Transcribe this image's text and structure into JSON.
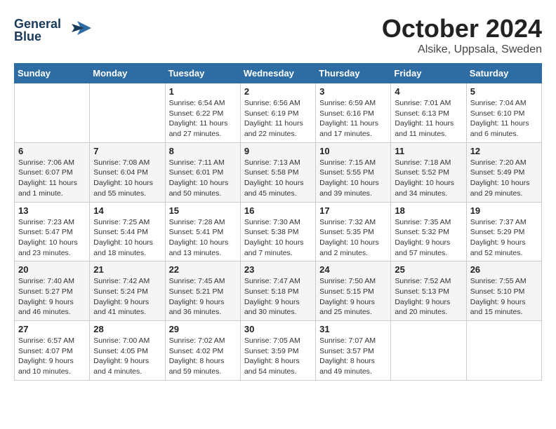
{
  "header": {
    "logo_line1": "General",
    "logo_line2": "Blue",
    "month": "October 2024",
    "location": "Alsike, Uppsala, Sweden"
  },
  "weekdays": [
    "Sunday",
    "Monday",
    "Tuesday",
    "Wednesday",
    "Thursday",
    "Friday",
    "Saturday"
  ],
  "weeks": [
    [
      {
        "day": "",
        "info": ""
      },
      {
        "day": "",
        "info": ""
      },
      {
        "day": "1",
        "info": "Sunrise: 6:54 AM\nSunset: 6:22 PM\nDaylight: 11 hours\nand 27 minutes."
      },
      {
        "day": "2",
        "info": "Sunrise: 6:56 AM\nSunset: 6:19 PM\nDaylight: 11 hours\nand 22 minutes."
      },
      {
        "day": "3",
        "info": "Sunrise: 6:59 AM\nSunset: 6:16 PM\nDaylight: 11 hours\nand 17 minutes."
      },
      {
        "day": "4",
        "info": "Sunrise: 7:01 AM\nSunset: 6:13 PM\nDaylight: 11 hours\nand 11 minutes."
      },
      {
        "day": "5",
        "info": "Sunrise: 7:04 AM\nSunset: 6:10 PM\nDaylight: 11 hours\nand 6 minutes."
      }
    ],
    [
      {
        "day": "6",
        "info": "Sunrise: 7:06 AM\nSunset: 6:07 PM\nDaylight: 11 hours\nand 1 minute."
      },
      {
        "day": "7",
        "info": "Sunrise: 7:08 AM\nSunset: 6:04 PM\nDaylight: 10 hours\nand 55 minutes."
      },
      {
        "day": "8",
        "info": "Sunrise: 7:11 AM\nSunset: 6:01 PM\nDaylight: 10 hours\nand 50 minutes."
      },
      {
        "day": "9",
        "info": "Sunrise: 7:13 AM\nSunset: 5:58 PM\nDaylight: 10 hours\nand 45 minutes."
      },
      {
        "day": "10",
        "info": "Sunrise: 7:15 AM\nSunset: 5:55 PM\nDaylight: 10 hours\nand 39 minutes."
      },
      {
        "day": "11",
        "info": "Sunrise: 7:18 AM\nSunset: 5:52 PM\nDaylight: 10 hours\nand 34 minutes."
      },
      {
        "day": "12",
        "info": "Sunrise: 7:20 AM\nSunset: 5:49 PM\nDaylight: 10 hours\nand 29 minutes."
      }
    ],
    [
      {
        "day": "13",
        "info": "Sunrise: 7:23 AM\nSunset: 5:47 PM\nDaylight: 10 hours\nand 23 minutes."
      },
      {
        "day": "14",
        "info": "Sunrise: 7:25 AM\nSunset: 5:44 PM\nDaylight: 10 hours\nand 18 minutes."
      },
      {
        "day": "15",
        "info": "Sunrise: 7:28 AM\nSunset: 5:41 PM\nDaylight: 10 hours\nand 13 minutes."
      },
      {
        "day": "16",
        "info": "Sunrise: 7:30 AM\nSunset: 5:38 PM\nDaylight: 10 hours\nand 7 minutes."
      },
      {
        "day": "17",
        "info": "Sunrise: 7:32 AM\nSunset: 5:35 PM\nDaylight: 10 hours\nand 2 minutes."
      },
      {
        "day": "18",
        "info": "Sunrise: 7:35 AM\nSunset: 5:32 PM\nDaylight: 9 hours\nand 57 minutes."
      },
      {
        "day": "19",
        "info": "Sunrise: 7:37 AM\nSunset: 5:29 PM\nDaylight: 9 hours\nand 52 minutes."
      }
    ],
    [
      {
        "day": "20",
        "info": "Sunrise: 7:40 AM\nSunset: 5:27 PM\nDaylight: 9 hours\nand 46 minutes."
      },
      {
        "day": "21",
        "info": "Sunrise: 7:42 AM\nSunset: 5:24 PM\nDaylight: 9 hours\nand 41 minutes."
      },
      {
        "day": "22",
        "info": "Sunrise: 7:45 AM\nSunset: 5:21 PM\nDaylight: 9 hours\nand 36 minutes."
      },
      {
        "day": "23",
        "info": "Sunrise: 7:47 AM\nSunset: 5:18 PM\nDaylight: 9 hours\nand 30 minutes."
      },
      {
        "day": "24",
        "info": "Sunrise: 7:50 AM\nSunset: 5:15 PM\nDaylight: 9 hours\nand 25 minutes."
      },
      {
        "day": "25",
        "info": "Sunrise: 7:52 AM\nSunset: 5:13 PM\nDaylight: 9 hours\nand 20 minutes."
      },
      {
        "day": "26",
        "info": "Sunrise: 7:55 AM\nSunset: 5:10 PM\nDaylight: 9 hours\nand 15 minutes."
      }
    ],
    [
      {
        "day": "27",
        "info": "Sunrise: 6:57 AM\nSunset: 4:07 PM\nDaylight: 9 hours\nand 10 minutes."
      },
      {
        "day": "28",
        "info": "Sunrise: 7:00 AM\nSunset: 4:05 PM\nDaylight: 9 hours\nand 4 minutes."
      },
      {
        "day": "29",
        "info": "Sunrise: 7:02 AM\nSunset: 4:02 PM\nDaylight: 8 hours\nand 59 minutes."
      },
      {
        "day": "30",
        "info": "Sunrise: 7:05 AM\nSunset: 3:59 PM\nDaylight: 8 hours\nand 54 minutes."
      },
      {
        "day": "31",
        "info": "Sunrise: 7:07 AM\nSunset: 3:57 PM\nDaylight: 8 hours\nand 49 minutes."
      },
      {
        "day": "",
        "info": ""
      },
      {
        "day": "",
        "info": ""
      }
    ]
  ]
}
